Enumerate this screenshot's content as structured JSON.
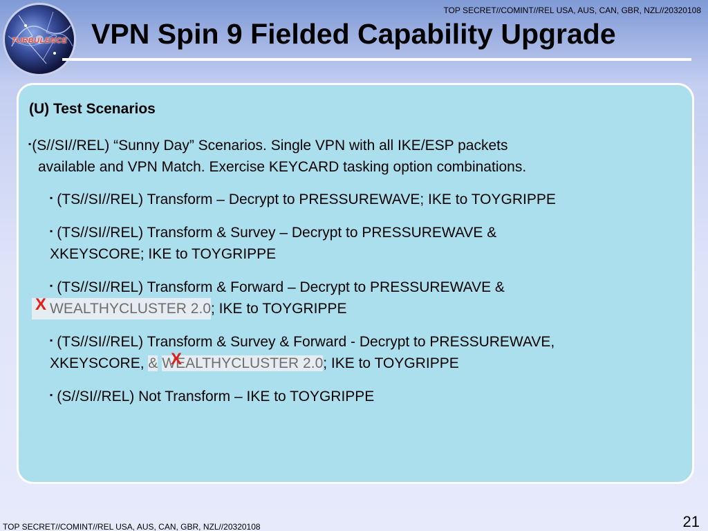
{
  "header": {
    "classification": "TOP SECRET//COMINT//REL USA, AUS, CAN, GBR, NZL//20320108",
    "title": "VPN Spin 9 Fielded Capability Upgrade",
    "logo_text": "TURBULENCE",
    "logo_icon": "turbulence-seal-icon"
  },
  "content": {
    "heading": "(U) Test Scenarios",
    "bullet_marker": "▪",
    "main_bullet": {
      "line1": "(S//SI//REL) “Sunny Day” Scenarios. Single VPN with all IKE/ESP packets",
      "line2": "available and VPN Match. Exercise KEYCARD tasking option combinations."
    },
    "sub_bullets": [
      {
        "line1": "(TS//SI//REL) Transform – Decrypt to PRESSUREWAVE; IKE to TOYGRIPPE"
      },
      {
        "line1": "(TS//SI//REL) Transform & Survey – Decrypt to PRESSUREWAVE &",
        "line2": "XKEYSCORE; IKE to TOYGRIPPE"
      },
      {
        "line1": "(TS//SI//REL) Transform & Forward – Decrypt to PRESSUREWAVE &",
        "line2_redacted": "WEALTHYCLUSTER 2.0",
        "line2_rest": "; IKE to TOYGRIPPE",
        "strike_mark": "X"
      },
      {
        "line1": "(TS//SI//REL) Transform & Survey & Forward - Decrypt to PRESSUREWAVE,",
        "line2_start": "XKEYSCORE, ",
        "line2_amp": "&",
        "line2_redacted": "WEALTHYCLUSTER 2.0",
        "line2_rest": "; IKE to TOYGRIPPE",
        "strike_mark": "X"
      },
      {
        "line1": "(S//SI//REL) Not Transform – IKE to TOYGRIPPE"
      }
    ]
  },
  "footer": {
    "classification": "TOP SECRET//COMINT//REL USA, AUS, CAN, GBR, NZL//20320108",
    "page_number": "21"
  },
  "colors": {
    "content_box": "#abdfee",
    "strike_mark": "#e0201b",
    "redacted_text": "#6e6e6e"
  }
}
